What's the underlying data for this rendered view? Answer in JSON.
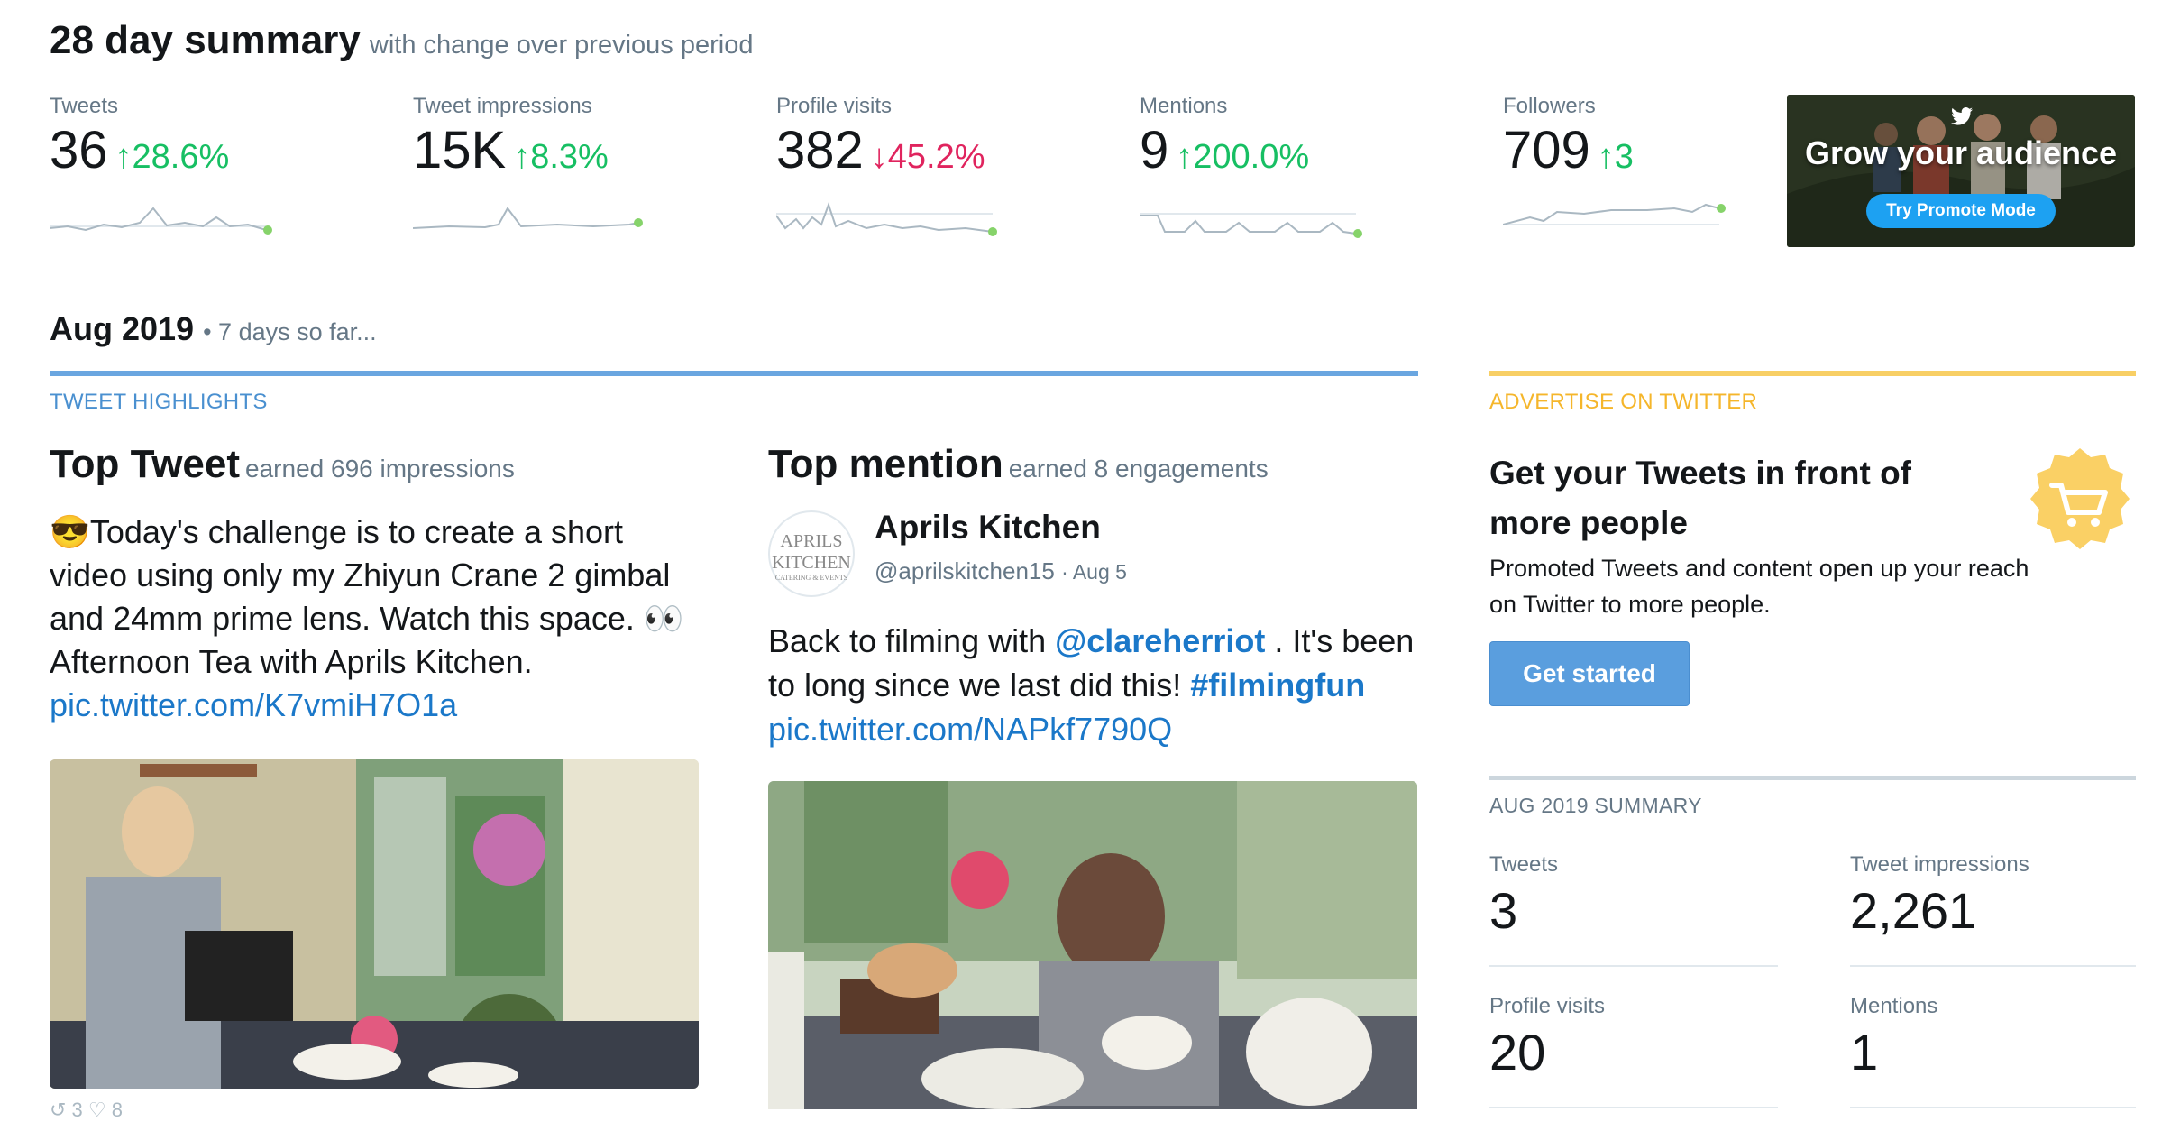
{
  "summary": {
    "title": "28 day summary",
    "subtitle": "with change over previous period",
    "metrics": [
      {
        "label": "Tweets",
        "value": "36",
        "change": "28.6%",
        "direction": "up"
      },
      {
        "label": "Tweet impressions",
        "value": "15K",
        "change": "8.3%",
        "direction": "up"
      },
      {
        "label": "Profile visits",
        "value": "382",
        "change": "45.2%",
        "direction": "down"
      },
      {
        "label": "Mentions",
        "value": "9",
        "change": "200.0%",
        "direction": "up"
      },
      {
        "label": "Followers",
        "value": "709",
        "change": "3",
        "direction": "up"
      }
    ],
    "promo": {
      "title": "Grow your audience",
      "button": "Try Promote Mode",
      "icon": "twitter-bird-icon"
    }
  },
  "period": {
    "month": "Aug 2019",
    "note": "• 7 days so far..."
  },
  "highlights": {
    "label": "TWEET HIGHLIGHTS",
    "top_tweet": {
      "title": "Top Tweet",
      "earned": "earned 696 impressions",
      "emoji_lead": "😎",
      "text": "Today's challenge is to create a short video using only my Zhiyun Crane 2 gimbal and 24mm prime lens. Watch this space. 👀 Afternoon Tea with Aprils Kitchen.",
      "link": "pic.twitter.com/K7vmiH7O1a"
    },
    "top_mention": {
      "title": "Top mention",
      "earned": "earned 8 engagements",
      "avatar_line1": "APRILS",
      "avatar_line2": "KITCHEN",
      "avatar_line3": "CATERING & EVENTS",
      "name": "Aprils Kitchen",
      "handle": "@aprilskitchen15",
      "date": "· Aug 5",
      "text_pre": "Back to filming with ",
      "mention": "@clareherriot",
      "text_mid": " . It's been to long since we last did this! ",
      "hashtag": "#filmingfun",
      "link": " pic.twitter.com/NAPkf7790Q"
    },
    "bottom_stats": "↺ 3   ♡ 8"
  },
  "advertise": {
    "label": "ADVERTISE ON TWITTER",
    "heading": "Get your Tweets in front of more people",
    "body": "Promoted Tweets and content open up your reach on Twitter to more people.",
    "button": "Get started",
    "icon": "shopping-cart-icon"
  },
  "aug_summary": {
    "label": "AUG 2019 SUMMARY",
    "items": [
      {
        "label": "Tweets",
        "value": "3"
      },
      {
        "label": "Tweet impressions",
        "value": "2,261"
      },
      {
        "label": "Profile visits",
        "value": "20"
      },
      {
        "label": "Mentions",
        "value": "1"
      }
    ]
  },
  "colors": {
    "up": "#17bf63",
    "down": "#e0245e",
    "link": "#1b78c9",
    "rule_blue": "#6aa6e0",
    "rule_yellow": "#f8cf65",
    "ad_label": "#f5b62b"
  }
}
